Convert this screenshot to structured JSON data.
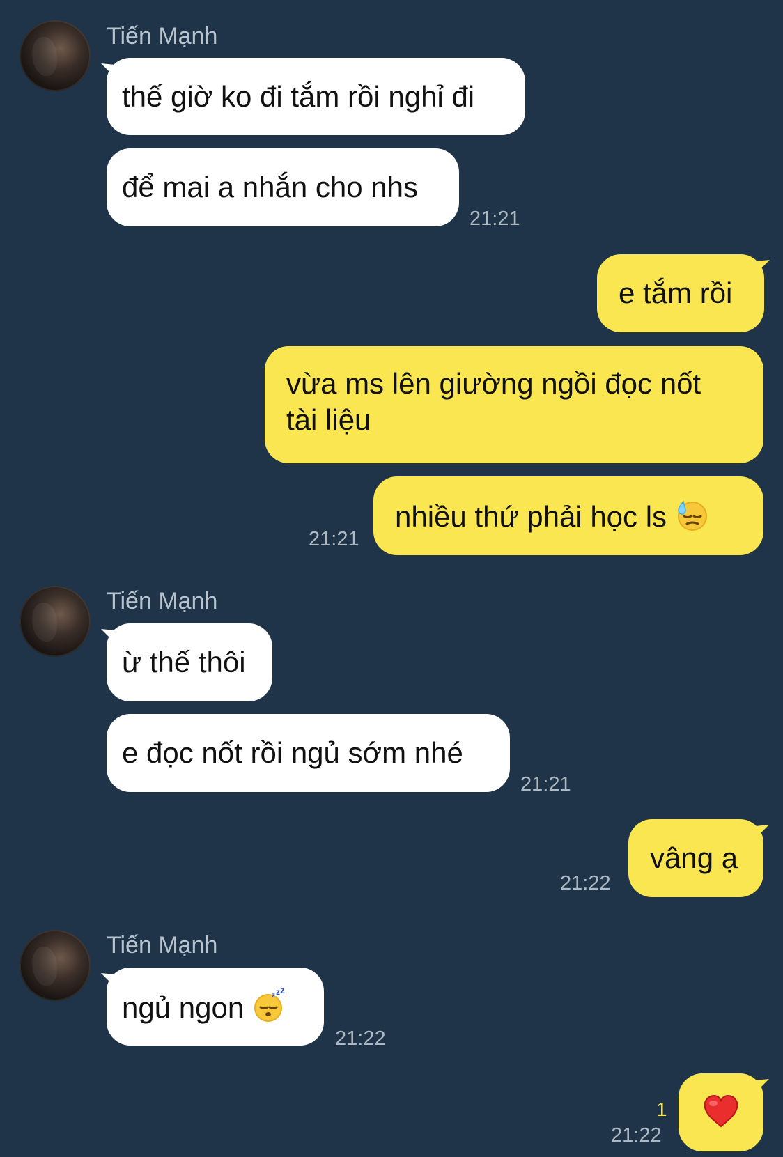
{
  "contact": {
    "name": "Tiến Mạnh"
  },
  "messages": {
    "m1": {
      "text": "thế giờ ko đi tắm rồi nghỉ đi"
    },
    "m2": {
      "text": "để mai a nhắn cho nhs"
    },
    "t1": "21:21",
    "m3": {
      "text": "e tắm rồi"
    },
    "m4": {
      "text": "vừa ms lên giường ngồi đọc nốt tài liệu"
    },
    "m5": {
      "text": "nhiều thứ phải học ls",
      "emoji": "downcast-face-with-sweat-icon"
    },
    "t2": "21:21",
    "m6": {
      "text": "ừ thế thôi"
    },
    "m7": {
      "text": "e đọc nốt rồi ngủ sớm nhé"
    },
    "t3": "21:21",
    "m8": {
      "text": "vâng ạ"
    },
    "t4": "21:22",
    "m9": {
      "text": "ngủ ngon",
      "emoji": "sleeping-face-icon"
    },
    "t5": "21:22",
    "m10": {
      "emoji": "red-heart-icon"
    },
    "read_count": "1",
    "t6": "21:22"
  },
  "colors": {
    "background": "#1f3448",
    "incoming_bubble": "#ffffff",
    "outgoing_bubble": "#f9e651",
    "timestamp": "#aeb8c2",
    "sender_name": "#b7c3ce",
    "read_count": "#f9e651"
  }
}
